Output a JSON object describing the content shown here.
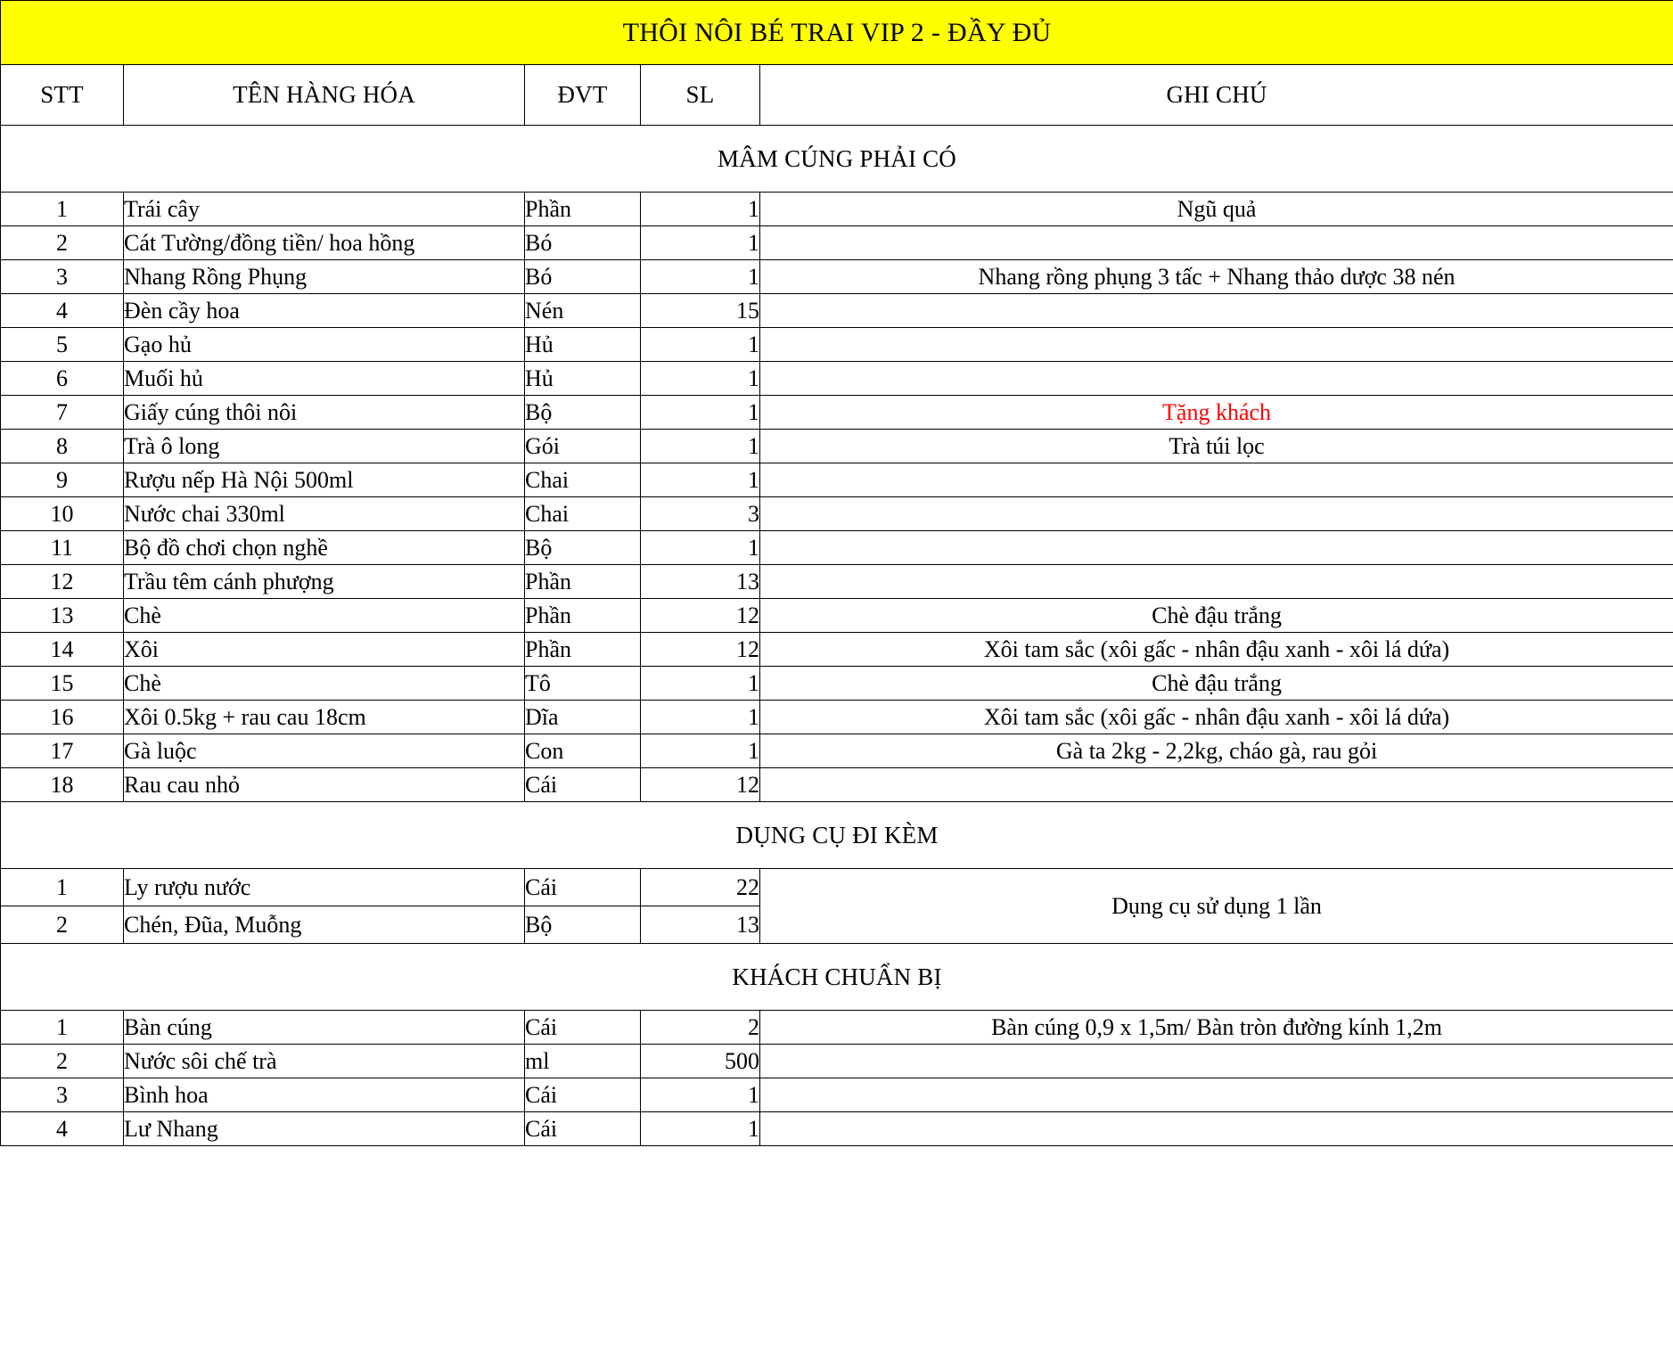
{
  "document": {
    "title": "THÔI NÔI BÉ TRAI VIP 2 - ĐẦY ĐỦ",
    "title_background": "#ffff00",
    "accent_red": "#ff0000"
  },
  "columns": {
    "stt": "STT",
    "name": "TÊN HÀNG HÓA",
    "dvt": "ĐVT",
    "sl": "SL",
    "note": "GHI CHÚ"
  },
  "sections": [
    {
      "heading": "MÂM CÚNG PHẢI CÓ",
      "rows": [
        {
          "stt": "1",
          "name": "Trái cây",
          "dvt": "Phần",
          "sl": "1",
          "note": "Ngũ quả"
        },
        {
          "stt": "2",
          "name": "Cát Tường/đồng tiền/ hoa hồng",
          "dvt": "Bó",
          "sl": "1",
          "note": ""
        },
        {
          "stt": "3",
          "name": "Nhang Rồng Phụng",
          "dvt": "Bó",
          "sl": "1",
          "note": "Nhang rồng phụng 3 tấc + Nhang thảo dược 38 nén"
        },
        {
          "stt": "4",
          "name": "Đèn cầy hoa",
          "dvt": "Nén",
          "sl": "15",
          "note": ""
        },
        {
          "stt": "5",
          "name": "Gạo hủ",
          "dvt": "Hủ",
          "sl": "1",
          "note": ""
        },
        {
          "stt": "6",
          "name": "Muối hủ",
          "dvt": "Hủ",
          "sl": "1",
          "note": ""
        },
        {
          "stt": "7",
          "name": "Giấy cúng thôi nôi",
          "dvt": "Bộ",
          "sl": "1",
          "note": "Tặng khách",
          "note_color": "red"
        },
        {
          "stt": "8",
          "name": "Trà ô long",
          "dvt": "Gói",
          "sl": "1",
          "note": "Trà túi lọc"
        },
        {
          "stt": "9",
          "name": "Rượu nếp Hà Nội 500ml",
          "dvt": "Chai",
          "sl": "1",
          "note": ""
        },
        {
          "stt": "10",
          "name": "Nước chai 330ml",
          "dvt": "Chai",
          "sl": "3",
          "note": ""
        },
        {
          "stt": "11",
          "name": "Bộ đồ chơi chọn nghề",
          "dvt": "Bộ",
          "sl": "1",
          "note": ""
        },
        {
          "stt": "12",
          "name": "Trầu têm cánh phượng",
          "dvt": "Phần",
          "sl": "13",
          "note": ""
        },
        {
          "stt": "13",
          "name": "Chè",
          "dvt": "Phần",
          "sl": "12",
          "note": "Chè đậu trắng"
        },
        {
          "stt": "14",
          "name": "Xôi",
          "dvt": "Phần",
          "sl": "12",
          "note": "Xôi tam sắc (xôi gấc - nhân đậu xanh - xôi lá dứa)"
        },
        {
          "stt": "15",
          "name": "Chè",
          "dvt": "Tô",
          "sl": "1",
          "note": "Chè đậu trắng"
        },
        {
          "stt": "16",
          "name": "Xôi 0.5kg + rau cau 18cm",
          "dvt": "Dĩa",
          "sl": "1",
          "note": "Xôi tam sắc (xôi gấc - nhân đậu xanh - xôi lá dứa)"
        },
        {
          "stt": "17",
          "name": "Gà luộc",
          "dvt": "Con",
          "sl": "1",
          "note": "Gà ta 2kg - 2,2kg, cháo gà, rau gỏi"
        },
        {
          "stt": "18",
          "name": "Rau cau nhỏ",
          "dvt": "Cái",
          "sl": "12",
          "note": ""
        }
      ]
    },
    {
      "heading": "DỤNG CỤ ĐI KÈM",
      "merged_note": "Dụng cụ sử dụng 1 lần",
      "rows": [
        {
          "stt": "1",
          "name": "Ly rượu nước",
          "dvt": "Cái",
          "sl": "22"
        },
        {
          "stt": "2",
          "name": "Chén, Đũa, Muỗng",
          "dvt": "Bộ",
          "sl": "13"
        }
      ]
    },
    {
      "heading": "KHÁCH CHUẨN BỊ",
      "rows": [
        {
          "stt": "1",
          "name": "Bàn cúng",
          "dvt": "Cái",
          "sl": "2",
          "note": "Bàn cúng 0,9 x 1,5m/ Bàn tròn đường kính 1,2m"
        },
        {
          "stt": "2",
          "name": "Nước sôi chế trà",
          "dvt": "ml",
          "sl": "500",
          "note": ""
        },
        {
          "stt": "3",
          "name": "Bình hoa",
          "dvt": "Cái",
          "sl": "1",
          "note": ""
        },
        {
          "stt": "4",
          "name": "Lư Nhang",
          "dvt": "Cái",
          "sl": "1",
          "note": ""
        }
      ]
    }
  ]
}
